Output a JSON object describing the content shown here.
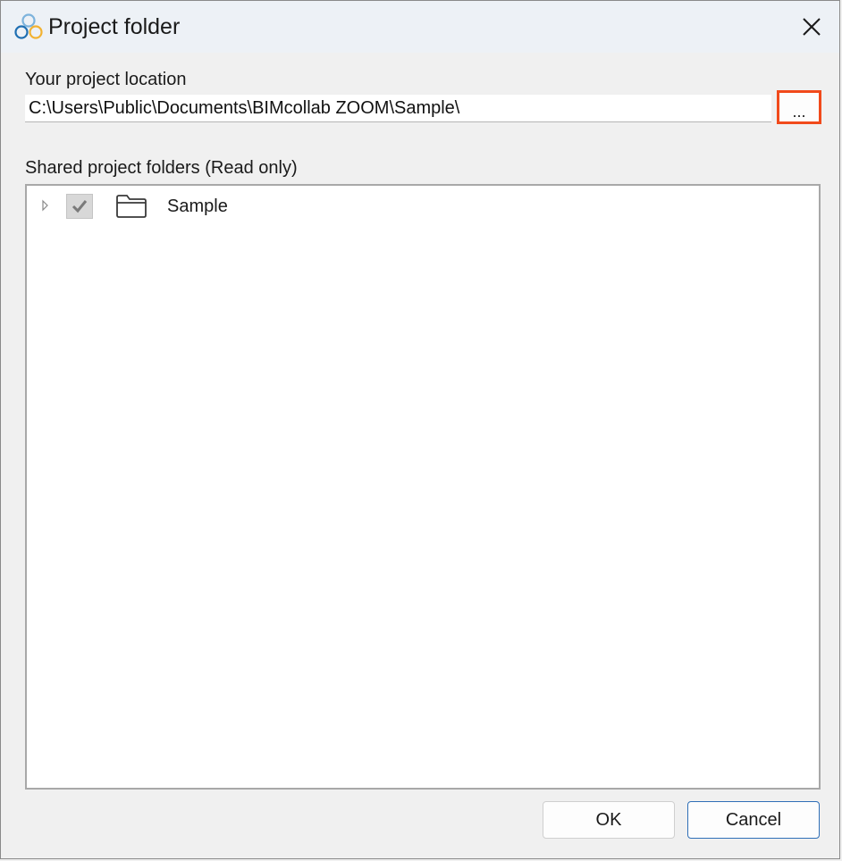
{
  "window": {
    "title": "Project folder",
    "icon": "bimcollab-logo-icon",
    "close_icon": "close-icon"
  },
  "location": {
    "label": "Your project location",
    "path_value": "C:\\Users\\Public\\Documents\\BIMcollab ZOOM\\Sample\\",
    "browse_label": "...",
    "browse_highlight_color": "#f14a1b"
  },
  "shared": {
    "label": "Shared project folders (Read only)",
    "items": [
      {
        "label": "Sample",
        "checked": true,
        "expanded": false,
        "icon": "folder-icon"
      }
    ]
  },
  "buttons": {
    "ok_label": "OK",
    "cancel_label": "Cancel"
  }
}
